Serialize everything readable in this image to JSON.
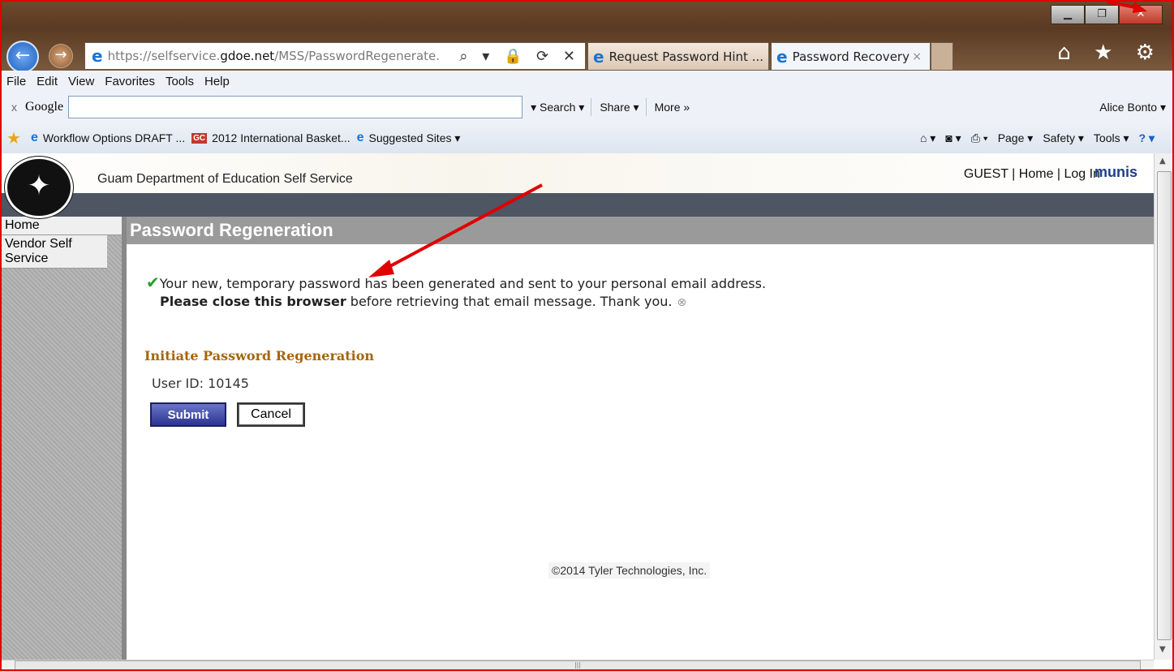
{
  "browser": {
    "address_url_scheme": "https://selfservice.",
    "address_url_domain": "gdoe.net",
    "address_url_path": "/MSS/PasswordRegenerate.",
    "address_tools": "⌕ ▾ 🔒 ⟳ ✕",
    "tabs": [
      {
        "label": "Request Password Hint ..."
      },
      {
        "label": "Password Recovery",
        "close": "×"
      }
    ],
    "window_buttons": {
      "minimize": "▁",
      "restore": "❐",
      "close": "✕"
    },
    "right_icons": "⌂ ★ ⚙"
  },
  "menubar": [
    "File",
    "Edit",
    "View",
    "Favorites",
    "Tools",
    "Help"
  ],
  "google_bar": {
    "close": "x",
    "logo": "Google",
    "search_placeholder": "",
    "items": [
      "▾ Search ▾",
      "Share ▾",
      "More »"
    ],
    "user": "Alice Bonto ▾"
  },
  "favorites_bar": {
    "items": [
      "Workflow Options DRAFT ...",
      "2012 International Basket...",
      "Suggested Sites ▾"
    ],
    "gc_badge": "GC",
    "commands": [
      "Page ▾",
      "Safety ▾",
      "Tools ▾"
    ]
  },
  "site": {
    "title": "Guam Department of Education Self Service",
    "links": "GUEST | Home | Log In",
    "brand": "munis",
    "page_heading": "Password Regeneration",
    "sidebar": [
      "Home",
      "Vendor Self Service"
    ],
    "message_line1": "Your new, temporary password has been generated and sent to your personal email address.",
    "message_bold": "Please close this browser",
    "message_rest": " before retrieving that email message. Thank you.",
    "section_heading": "Initiate Password Regeneration",
    "user_id_label": "User ID: 10145",
    "submit_label": "Submit",
    "cancel_label": "Cancel",
    "copyright": "©2014 Tyler Technologies, Inc."
  },
  "colors": {
    "annotation": "#e00000",
    "heading_bar": "#9a9a9a",
    "section_heading": "#a5660b"
  }
}
